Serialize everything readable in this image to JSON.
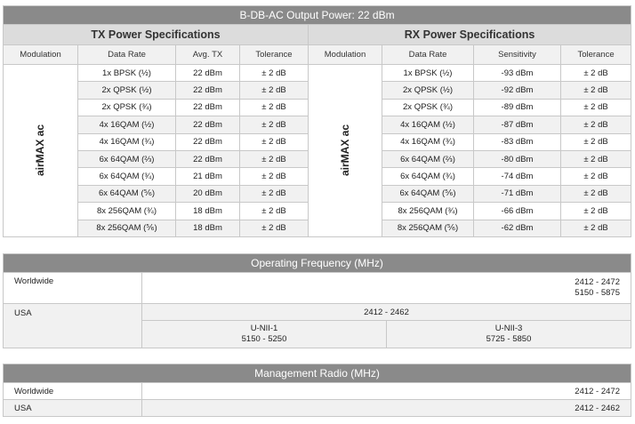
{
  "title": "B-DB-AC Output Power: 22 dBm",
  "tx": {
    "heading": "TX Power Specifications",
    "col_modulation": "Modulation",
    "col_rate": "Data Rate",
    "col_avg": "Avg. TX",
    "col_tol": "Tolerance",
    "modulation": "airMAX ac",
    "rows": [
      {
        "rate": "1x BPSK (½)",
        "avg": "22 dBm",
        "tol": "± 2 dB"
      },
      {
        "rate": "2x QPSK (½)",
        "avg": "22 dBm",
        "tol": "± 2 dB"
      },
      {
        "rate": "2x QPSK (¾)",
        "avg": "22 dBm",
        "tol": "± 2 dB"
      },
      {
        "rate": "4x 16QAM (½)",
        "avg": "22 dBm",
        "tol": "± 2 dB"
      },
      {
        "rate": "4x 16QAM (¾)",
        "avg": "22 dBm",
        "tol": "± 2 dB"
      },
      {
        "rate": "6x 64QAM (⅔)",
        "avg": "22 dBm",
        "tol": "± 2 dB"
      },
      {
        "rate": "6x 64QAM (¾)",
        "avg": "21 dBm",
        "tol": "± 2 dB"
      },
      {
        "rate": "6x 64QAM (⅚)",
        "avg": "20 dBm",
        "tol": "± 2 dB"
      },
      {
        "rate": "8x 256QAM (¾)",
        "avg": "18 dBm",
        "tol": "± 2 dB"
      },
      {
        "rate": "8x 256QAM (⅚)",
        "avg": "18 dBm",
        "tol": "± 2 dB"
      }
    ]
  },
  "rx": {
    "heading": "RX Power Specifications",
    "col_modulation": "Modulation",
    "col_rate": "Data Rate",
    "col_sens": "Sensitivity",
    "col_tol": "Tolerance",
    "modulation": "airMAX ac",
    "rows": [
      {
        "rate": "1x BPSK (½)",
        "sens": "-93 dBm",
        "tol": "± 2 dB"
      },
      {
        "rate": "2x QPSK (½)",
        "sens": "-92 dBm",
        "tol": "± 2 dB"
      },
      {
        "rate": "2x QPSK (¾)",
        "sens": "-89 dBm",
        "tol": "± 2 dB"
      },
      {
        "rate": "4x 16QAM (½)",
        "sens": "-87 dBm",
        "tol": "± 2 dB"
      },
      {
        "rate": "4x 16QAM (¾)",
        "sens": "-83 dBm",
        "tol": "± 2 dB"
      },
      {
        "rate": "6x 64QAM (⅔)",
        "sens": "-80 dBm",
        "tol": "± 2 dB"
      },
      {
        "rate": "6x 64QAM (¾)",
        "sens": "-74 dBm",
        "tol": "± 2 dB"
      },
      {
        "rate": "6x 64QAM (⅚)",
        "sens": "-71 dBm",
        "tol": "± 2 dB"
      },
      {
        "rate": "8x 256QAM (¾)",
        "sens": "-66 dBm",
        "tol": "± 2 dB"
      },
      {
        "rate": "8x 256QAM (⅚)",
        "sens": "-62 dBm",
        "tol": "± 2 dB"
      }
    ]
  },
  "freq": {
    "heading": "Operating Frequency (MHz)",
    "worldwide_label": "Worldwide",
    "worldwide_value1": "2412 - 2472",
    "worldwide_value2": "5150 - 5875",
    "usa_label": "USA",
    "usa_value": "2412 - 2462",
    "unii1_label": "U-NII-1",
    "unii1_value": "5150 - 5250",
    "unii3_label": "U-NII-3",
    "unii3_value": "5725 - 5850"
  },
  "mgmt": {
    "heading": "Management Radio (MHz)",
    "worldwide_label": "Worldwide",
    "worldwide_value": "2412 - 2472",
    "usa_label": "USA",
    "usa_value": "2412 - 2462"
  }
}
